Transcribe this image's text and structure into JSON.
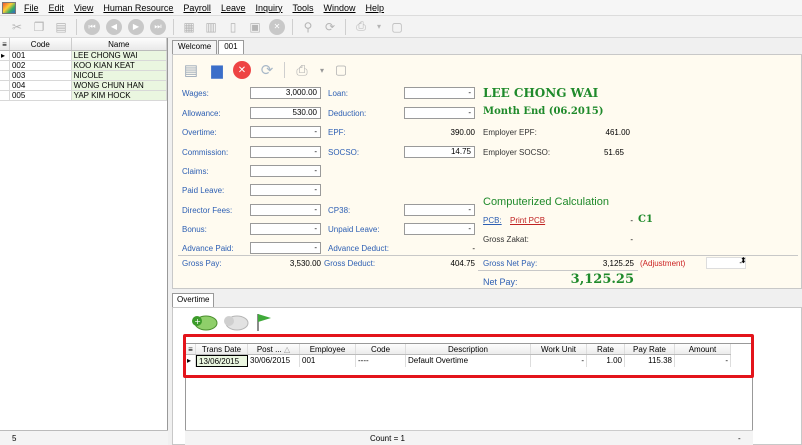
{
  "menu": [
    "File",
    "Edit",
    "View",
    "Human Resource",
    "Payroll",
    "Leave",
    "Inquiry",
    "Tools",
    "Window",
    "Help"
  ],
  "employee_grid": {
    "headers": [
      "Code",
      "Name"
    ],
    "rows": [
      {
        "code": "001",
        "name": "LEE CHONG WAI"
      },
      {
        "code": "002",
        "name": "KOO KIAN KEAT"
      },
      {
        "code": "003",
        "name": "NICOLE"
      },
      {
        "code": "004",
        "name": "WONG CHUN HAN"
      },
      {
        "code": "005",
        "name": "YAP KIM HOCK"
      }
    ],
    "footer_count": "5"
  },
  "tabs": [
    "Welcome",
    "001"
  ],
  "form": {
    "wages_label": "Wages:",
    "wages": "3,000.00",
    "allowance_label": "Allowance:",
    "allowance": "530.00",
    "overtime_label": "Overtime:",
    "overtime": "-",
    "commission_label": "Commission:",
    "commission": "-",
    "claims_label": "Claims:",
    "claims": "-",
    "paid_leave_label": "Paid Leave:",
    "paid_leave": "-",
    "director_fees_label": "Director Fees:",
    "director_fees": "-",
    "bonus_label": "Bonus:",
    "bonus": "-",
    "advance_paid_label": "Advance Paid:",
    "advance_paid": "-",
    "loan_label": "Loan:",
    "loan": "-",
    "deduction_label": "Deduction:",
    "deduction": "-",
    "epf_label": "EPF:",
    "epf": "390.00",
    "socso_label": "SOCSO:",
    "socso": "14.75",
    "cp38_label": "CP38:",
    "cp38": "-",
    "unpaid_leave_label": "Unpaid Leave:",
    "unpaid_leave": "-",
    "advance_deduct_label": "Advance Deduct:",
    "advance_deduct": "-",
    "employee_name": "LEE CHONG WAI",
    "period": "Month End (06.2015)",
    "employer_epf_label": "Employer EPF:",
    "employer_epf": "461.00",
    "employer_socso_label": "Employer SOCSO:",
    "employer_socso": "51.65",
    "computerized": "Computerized Calculation",
    "pcb_label": "PCB:",
    "print_pcb": "Print PCB",
    "pcb_value": "-",
    "pcb_code": "C1",
    "gross_zakat_label": "Gross Zakat:",
    "gross_zakat": "-",
    "gross_pay_label": "Gross Pay:",
    "gross_pay": "3,530.00",
    "gross_deduct_label": "Gross Deduct:",
    "gross_deduct": "404.75",
    "gross_net_label": "Gross Net Pay:",
    "gross_net": "3,125.25",
    "adjustment_label": "(Adjustment)",
    "adjustment": "-",
    "net_pay_label": "Net Pay:",
    "net_pay": "3,125.25"
  },
  "overtime": {
    "tab": "Overtime",
    "headers": [
      "Trans Date",
      "Post ...",
      "Employee",
      "Code",
      "Description",
      "Work Unit",
      "Rate",
      "Pay Rate",
      "Amount"
    ],
    "row": [
      "13/06/2015",
      "30/06/2015",
      "001",
      "----",
      "Default Overtime",
      "-",
      "1.00",
      "115.38",
      "-"
    ],
    "count": "Count = 1",
    "footer_dash": "-"
  },
  "colors": {
    "label_blue": "#2d5fb3",
    "accent_green": "#1f8a2b",
    "highlight_red": "#e3141b",
    "adjust_red": "#cc2222"
  }
}
